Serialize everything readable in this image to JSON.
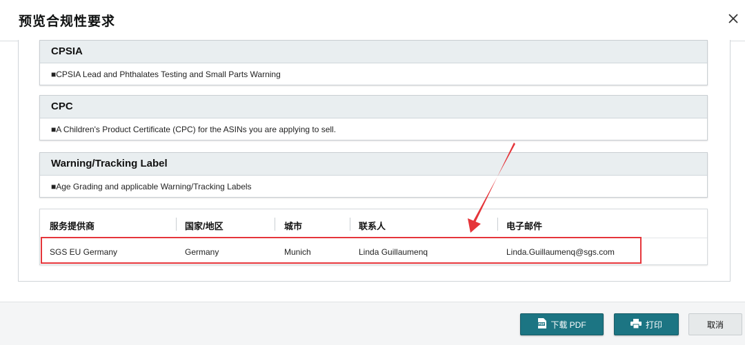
{
  "modal": {
    "title": "预览合规性要求",
    "close_icon": "close-icon"
  },
  "sections": [
    {
      "title": "CPSIA",
      "bullet": "■",
      "text": "CPSIA Lead and Phthalates Testing and Small Parts Warning"
    },
    {
      "title": "CPC",
      "bullet": "■",
      "text": "A Children's Product Certificate (CPC) for the ASINs you are applying to sell."
    },
    {
      "title": "Warning/Tracking Label",
      "bullet": "■",
      "text": "Age Grading and applicable Warning/Tracking Labels"
    }
  ],
  "provider_table": {
    "headers": [
      "服务提供商",
      "国家/地区",
      "城市",
      "联系人",
      "电子邮件"
    ],
    "rows": [
      [
        "SGS EU Germany",
        "Germany",
        "Munich",
        "Linda Guillaumenq",
        "Linda.Guillaumenq@sgs.com"
      ]
    ]
  },
  "annotation": {
    "highlight_color": "#e5353a"
  },
  "footer": {
    "download_pdf_label": "下载 PDF",
    "download_icon": "pdf-file-icon",
    "print_label": "打印",
    "print_icon": "printer-icon",
    "cancel_label": "取消"
  },
  "colors": {
    "primary_button": "#1c7583",
    "section_header_bg": "#e9eef0"
  }
}
